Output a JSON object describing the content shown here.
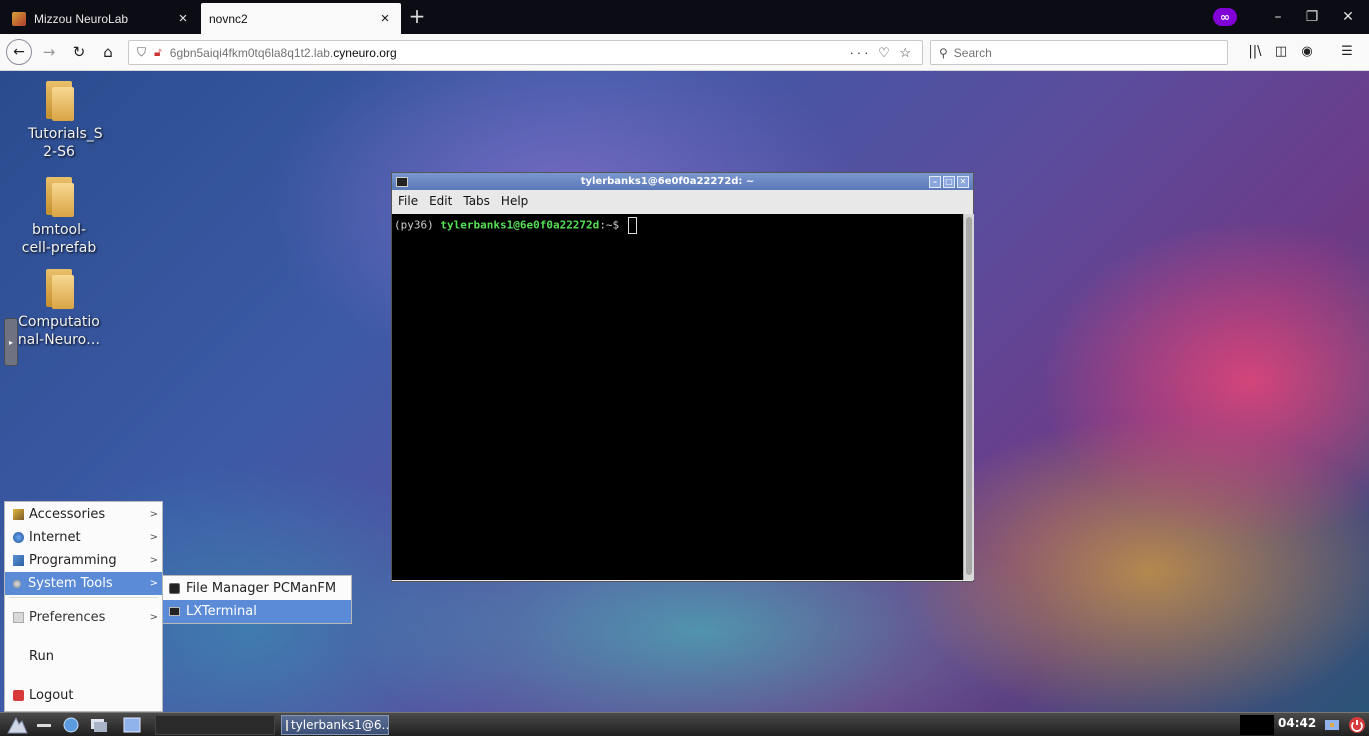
{
  "browser": {
    "tabs": [
      {
        "title": "Mizzou NeuroLab",
        "close": "×",
        "active": false
      },
      {
        "title": "novnc2",
        "close": "×",
        "active": true
      }
    ],
    "new_tab": "+",
    "private_badge": "∞",
    "window_controls": {
      "minimize": "–",
      "restore": "❐",
      "close": "✕"
    },
    "nav": {
      "back": "←",
      "forward": "→",
      "reload": "↻",
      "home": "⌂"
    },
    "url": {
      "prefix": "6gbn5aiqi4fkm0tq6la8q1t2.lab.",
      "host": "cyneuro.org",
      "actions": "··· ♡ ☆"
    },
    "search": {
      "placeholder": "Search",
      "icon": "search-icon"
    },
    "toolbar_icons": [
      "library-icon",
      "sidebar-icon",
      "account-icon",
      "menu-icon"
    ]
  },
  "desktop": {
    "icons": [
      {
        "label": "Tutorials_S 2-S6"
      },
      {
        "label": "bmtool- cell-prefab"
      },
      {
        "label": "Computatio nal-Neuro…"
      }
    ]
  },
  "terminal": {
    "title": "tylerbanks1@6e0f0a22272d: ~",
    "menu": [
      "File",
      "Edit",
      "Tabs",
      "Help"
    ],
    "prompt": {
      "env": "(py36) ",
      "user": "tylerbanks1@6e0f0a22272d",
      "symbols": ":~$ "
    }
  },
  "start_menu": {
    "items": [
      {
        "label": "Accessories",
        "icon": "accessories-icon"
      },
      {
        "label": "Internet",
        "icon": "globe-icon"
      },
      {
        "label": "Programming",
        "icon": "programming-icon"
      },
      {
        "label": "System Tools",
        "icon": "gear-icon"
      },
      {
        "label": "Preferences",
        "icon": "preferences-icon"
      },
      {
        "label": "Run"
      },
      {
        "label": "Logout",
        "icon": "logout-icon"
      }
    ],
    "submenu": [
      {
        "label": "File Manager PCManFM",
        "icon": "file-manager-icon"
      },
      {
        "label": "LXTerminal",
        "icon": "terminal-icon"
      }
    ]
  },
  "taskbar": {
    "task_label": "tylerbanks1@6…",
    "clock": "04:42"
  },
  "colors": {
    "menu_highlight": "#5b8bd6",
    "prompt_green": "#55e055",
    "private_purple": "#8000d7"
  }
}
